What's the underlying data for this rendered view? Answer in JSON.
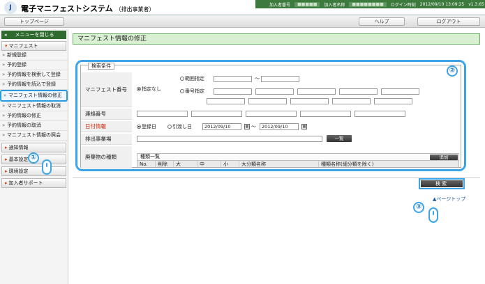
{
  "header": {
    "title": "電子マニフェストシステム",
    "subtitle": "（排出事業者）",
    "user_no_label": "加入者番号",
    "user_no": "■■■■■",
    "user_name_label": "加入者名称",
    "user_name": "■■■■■■■■",
    "login_label": "ログイン時刻",
    "login_time": "2012/09/10 13:09:25",
    "version": "v1.3.65"
  },
  "nav": {
    "top": "トップページ",
    "help": "ヘルプ",
    "logout": "ログアウト"
  },
  "sidebar": {
    "close": "メニューを閉じる",
    "manifest": "マニフェスト",
    "items": [
      "新規登録",
      "予約登録",
      "予約情報を検索して登録",
      "予約情報を読込で登録",
      "マニフェスト情報の修正",
      "マニフェスト情報の取消",
      "予約情報の修正",
      "予約情報の取消",
      "マニフェスト情報の照会"
    ],
    "sections": [
      "通知情報",
      "基本設定",
      "環境設定",
      "加入者サポート"
    ]
  },
  "page": {
    "title": "マニフェスト情報の修正"
  },
  "search": {
    "legend": "検索条件",
    "manifest_no": "マニフェスト番号",
    "none": "指定なし",
    "range": "範囲指定",
    "tilde": "～",
    "number": "番号指定",
    "contact_no": "連絡番号",
    "date_info": "日付情報",
    "reg_date": "登録日",
    "delivery_date": "引渡し日",
    "date_from": "2012/09/10",
    "date_to": "2012/09/10",
    "emitter": "排出事業場",
    "list_btn": "一覧",
    "waste_type": "廃棄物の種類",
    "type_list": "種類一覧",
    "add_btn": "追加",
    "cols": [
      "No.",
      "削除",
      "大",
      "中",
      "小",
      "大分類名称",
      "種類名称(細分類を除く)"
    ],
    "search_btn": "検索",
    "page_top": "ページトップ"
  },
  "annotations": {
    "b1": "①",
    "b2": "②",
    "b3": "③"
  }
}
